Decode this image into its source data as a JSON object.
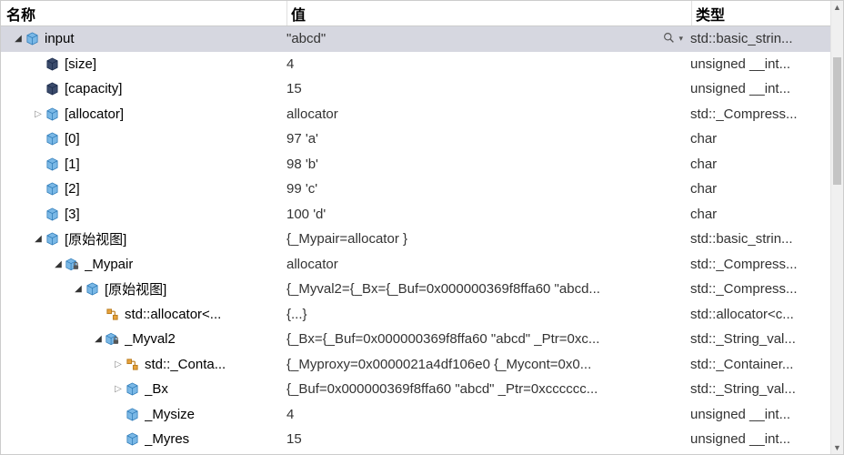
{
  "columns": {
    "name": "名称",
    "value": "值",
    "type": "类型"
  },
  "icons": {
    "cube_blue": "cube-blue",
    "cube_dark": "cube-dark",
    "cube_lock": "cube-lock",
    "inherit": "inherit-orange"
  },
  "rows": [
    {
      "indent": 0,
      "exp": "open",
      "icon": "cube_blue",
      "name": "input",
      "value": "\"abcd\"",
      "type": "std::basic_strin...",
      "selected": true,
      "search": true
    },
    {
      "indent": 1,
      "exp": "none",
      "icon": "cube_dark",
      "name": "[size]",
      "value": "4",
      "type": "unsigned __int..."
    },
    {
      "indent": 1,
      "exp": "none",
      "icon": "cube_dark",
      "name": "[capacity]",
      "value": "15",
      "type": "unsigned __int..."
    },
    {
      "indent": 1,
      "exp": "closed",
      "icon": "cube_blue",
      "name": "[allocator]",
      "value": "allocator",
      "type": "std::_Compress..."
    },
    {
      "indent": 1,
      "exp": "none",
      "icon": "cube_blue",
      "name": "[0]",
      "value": "97 'a'",
      "type": "char"
    },
    {
      "indent": 1,
      "exp": "none",
      "icon": "cube_blue",
      "name": "[1]",
      "value": "98 'b'",
      "type": "char"
    },
    {
      "indent": 1,
      "exp": "none",
      "icon": "cube_blue",
      "name": "[2]",
      "value": "99 'c'",
      "type": "char"
    },
    {
      "indent": 1,
      "exp": "none",
      "icon": "cube_blue",
      "name": "[3]",
      "value": "100 'd'",
      "type": "char"
    },
    {
      "indent": 1,
      "exp": "open",
      "icon": "cube_blue",
      "name": "[原始视图]",
      "value": "{_Mypair=allocator }",
      "type": "std::basic_strin..."
    },
    {
      "indent": 2,
      "exp": "open",
      "icon": "cube_lock",
      "name": "_Mypair",
      "value": "allocator",
      "type": "std::_Compress..."
    },
    {
      "indent": 3,
      "exp": "open",
      "icon": "cube_blue",
      "name": "[原始视图]",
      "value": "{_Myval2={_Bx={_Buf=0x000000369f8ffa60 \"abcd...",
      "type": "std::_Compress..."
    },
    {
      "indent": 4,
      "exp": "none",
      "icon": "inherit",
      "name": "std::allocator<...",
      "value": "{...}",
      "type": "std::allocator<c..."
    },
    {
      "indent": 4,
      "exp": "open",
      "icon": "cube_lock",
      "name": "_Myval2",
      "value": "{_Bx={_Buf=0x000000369f8ffa60 \"abcd\" _Ptr=0xc...",
      "type": "std::_String_val..."
    },
    {
      "indent": 5,
      "exp": "closed",
      "icon": "inherit",
      "name": "std::_Conta...",
      "value": "{_Myproxy=0x0000021a4df106e0 {_Mycont=0x0...",
      "type": "std::_Container..."
    },
    {
      "indent": 5,
      "exp": "closed",
      "icon": "cube_blue",
      "name": "_Bx",
      "value": "{_Buf=0x000000369f8ffa60 \"abcd\" _Ptr=0xcccccc...",
      "type": "std::_String_val..."
    },
    {
      "indent": 5,
      "exp": "none",
      "icon": "cube_blue",
      "name": "_Mysize",
      "value": "4",
      "type": "unsigned __int..."
    },
    {
      "indent": 5,
      "exp": "none",
      "icon": "cube_blue",
      "name": "_Myres",
      "value": "15",
      "type": "unsigned __int..."
    }
  ]
}
